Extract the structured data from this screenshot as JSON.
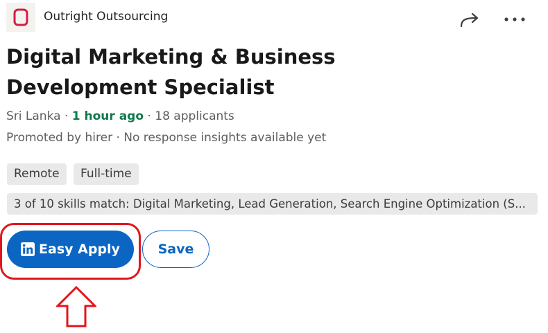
{
  "header": {
    "company_name": "Outright Outsourcing",
    "logo_icon": "company-logo-icon",
    "share_icon": "share-arrow-icon",
    "more_icon": "more-options-icon"
  },
  "job": {
    "title": "Digital Marketing & Business Development Specialist",
    "location": "Sri Lanka",
    "separator": " · ",
    "posted": "1 hour ago",
    "applicants": "18 applicants",
    "promoted_line": "Promoted by hirer · No response insights available yet",
    "workplace_type": "Remote",
    "employment_type": "Full-time",
    "skills_match": "3 of 10 skills match: Digital Marketing, Lead Generation, Search Engine Optimization (S..."
  },
  "actions": {
    "easy_apply_label": "Easy Apply",
    "save_label": "Save"
  },
  "colors": {
    "brand_blue": "#0a66c2",
    "posted_green": "#0e7a4b",
    "annotation_red": "#e3151c",
    "logo_red": "#d11d46"
  }
}
